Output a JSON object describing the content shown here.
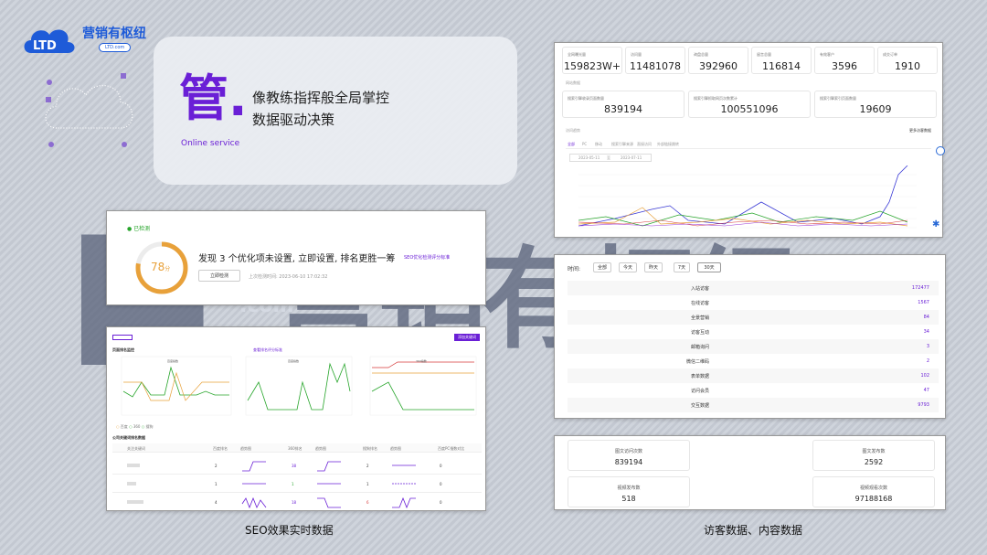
{
  "logo": {
    "brand": "营销有枢纽",
    "badge": "LTD.com",
    "mark": "LTD"
  },
  "hero": {
    "big": "管.",
    "sub": "Online service",
    "line1": "像教练指挥般全局掌控",
    "line2": "数据驱动决策"
  },
  "background": {
    "com": ".com"
  },
  "stats": {
    "top": [
      {
        "label": "全网曝光量",
        "value": "159823W+"
      },
      {
        "label": "访问量",
        "value": "11481078"
      },
      {
        "label": "询盘总量",
        "value": "392960"
      },
      {
        "label": "留言总量",
        "value": "116814"
      },
      {
        "label": "有效客户",
        "value": "3596"
      },
      {
        "label": "成交订单",
        "value": "1910"
      }
    ],
    "section2": "网站数据",
    "second": [
      {
        "label": "搜索引擎收录页面数量",
        "value": "839194"
      },
      {
        "label": "搜索引擎抓取网页次数累计",
        "value": "100551096"
      },
      {
        "label": "搜索引擎索引页面数量",
        "value": "19609"
      }
    ],
    "section3": "访问趋势",
    "link": "更多访客数据",
    "tabs": [
      "全部",
      "PC",
      "移动",
      "搜索引擎来源",
      "直接访问",
      "外部链接跳转"
    ],
    "date_from": "2023-05-11",
    "date_sep": "至",
    "date_to": "2023-07-11"
  },
  "optimize": {
    "status": "已检测",
    "score": "78",
    "score_unit": "分",
    "message": "发现 3 个优化项未设置, 立即设置, 排名更胜一筹",
    "link": "SEO优化检测评分标准",
    "button": "立即检测",
    "last_check": "上次检测时间: 2023-06-10 17:02:32"
  },
  "seo": {
    "title1": "页面排名监控",
    "link1": "查看排名评分标准",
    "btn": "添加关键词",
    "charts": [
      "百度指数",
      "百度指数",
      "360指数"
    ],
    "legend": [
      "百度",
      "360",
      "搜狗"
    ],
    "title2": "公司关键词排名数据",
    "cols": [
      "关注关键词",
      "百度排名",
      "趋势图",
      "360排名",
      "趋势图",
      "搜狗排名",
      "趋势图",
      "百度PC指数对比"
    ],
    "rows": [
      {
        "baidu": "2",
        "s360": "38",
        "sogou": "2",
        "idx": "0"
      },
      {
        "baidu": "1",
        "s360": "1",
        "sogou": "1",
        "idx": "0"
      },
      {
        "baidu": "4",
        "s360": "18",
        "sogou": "6",
        "idx": "0"
      }
    ]
  },
  "visitors": {
    "time_label": "时间:",
    "ranges": [
      "全部",
      "今天",
      "昨天",
      "7天",
      "30天"
    ],
    "rows": [
      {
        "label": "入站访客",
        "value": "172477"
      },
      {
        "label": "在线访客",
        "value": "1567"
      },
      {
        "label": "全景营销",
        "value": "84"
      },
      {
        "label": "访客互动",
        "value": "34"
      },
      {
        "label": "邮箱询问",
        "value": "3"
      },
      {
        "label": "微信二维码",
        "value": "2"
      },
      {
        "label": "表单数据",
        "value": "102"
      },
      {
        "label": "访问会员",
        "value": "47"
      },
      {
        "label": "交互数据",
        "value": "9793"
      }
    ]
  },
  "content": [
    {
      "label": "图文访问次数",
      "value": "839194"
    },
    {
      "label": "图文发布数",
      "value": "2592"
    },
    {
      "label": "视频发布数",
      "value": "518"
    },
    {
      "label": "视频观看次数",
      "value": "97188168"
    }
  ],
  "captions": {
    "left": "SEO效果实时数据",
    "right": "访客数据、内容数据"
  },
  "colors": {
    "accent": "#6a1fd6",
    "brand": "#1e5bd8",
    "score": "#e8a13a",
    "green": "#27a52b"
  }
}
